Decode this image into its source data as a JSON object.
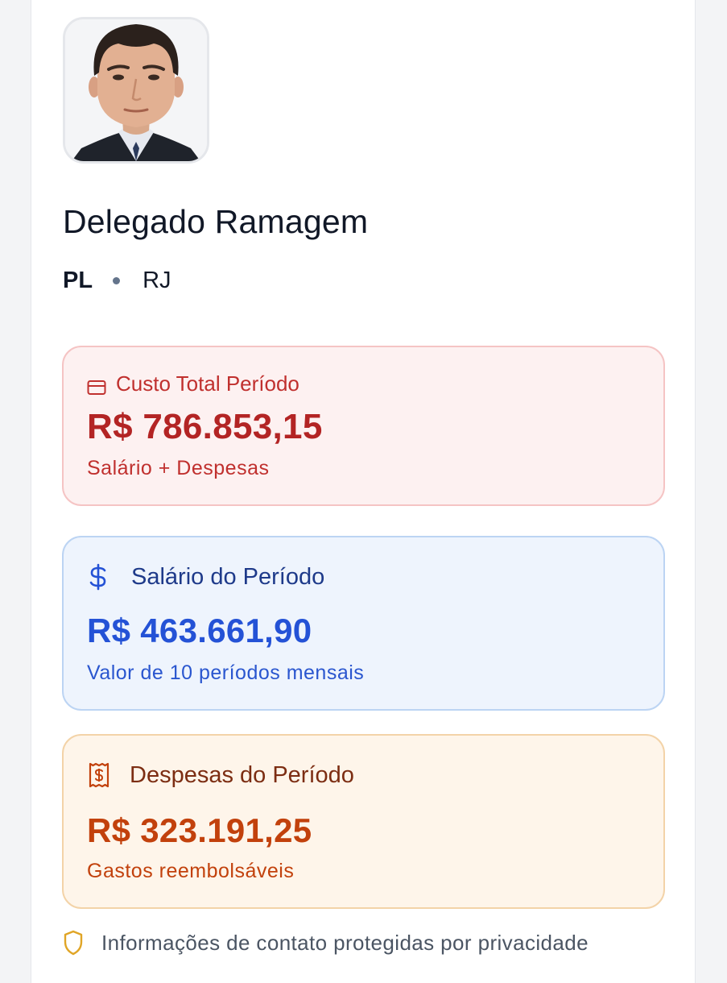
{
  "profile": {
    "photo_alt": "Foto",
    "name": "Delegado Ramagem",
    "party": "PL",
    "state": "RJ"
  },
  "stats": {
    "total": {
      "icon": "credit-card-icon",
      "label": "Custo Total Período",
      "value": "R$ 786.853,15",
      "sub": "Salário + Despesas",
      "color": "#b32424"
    },
    "salary": {
      "icon": "dollar-sign-icon",
      "label": "Salário do Período",
      "value": "R$ 463.661,90",
      "sub": "Valor de 10 períodos mensais",
      "color": "#2452d6"
    },
    "expenses": {
      "icon": "receipt-icon",
      "label": "Despesas do Período",
      "value": "R$ 323.191,25",
      "sub": "Gastos reembolsáveis",
      "color": "#c2410c"
    }
  },
  "privacy": {
    "icon": "shield-icon",
    "text": "Informações de contato protegidas por privacidade"
  }
}
